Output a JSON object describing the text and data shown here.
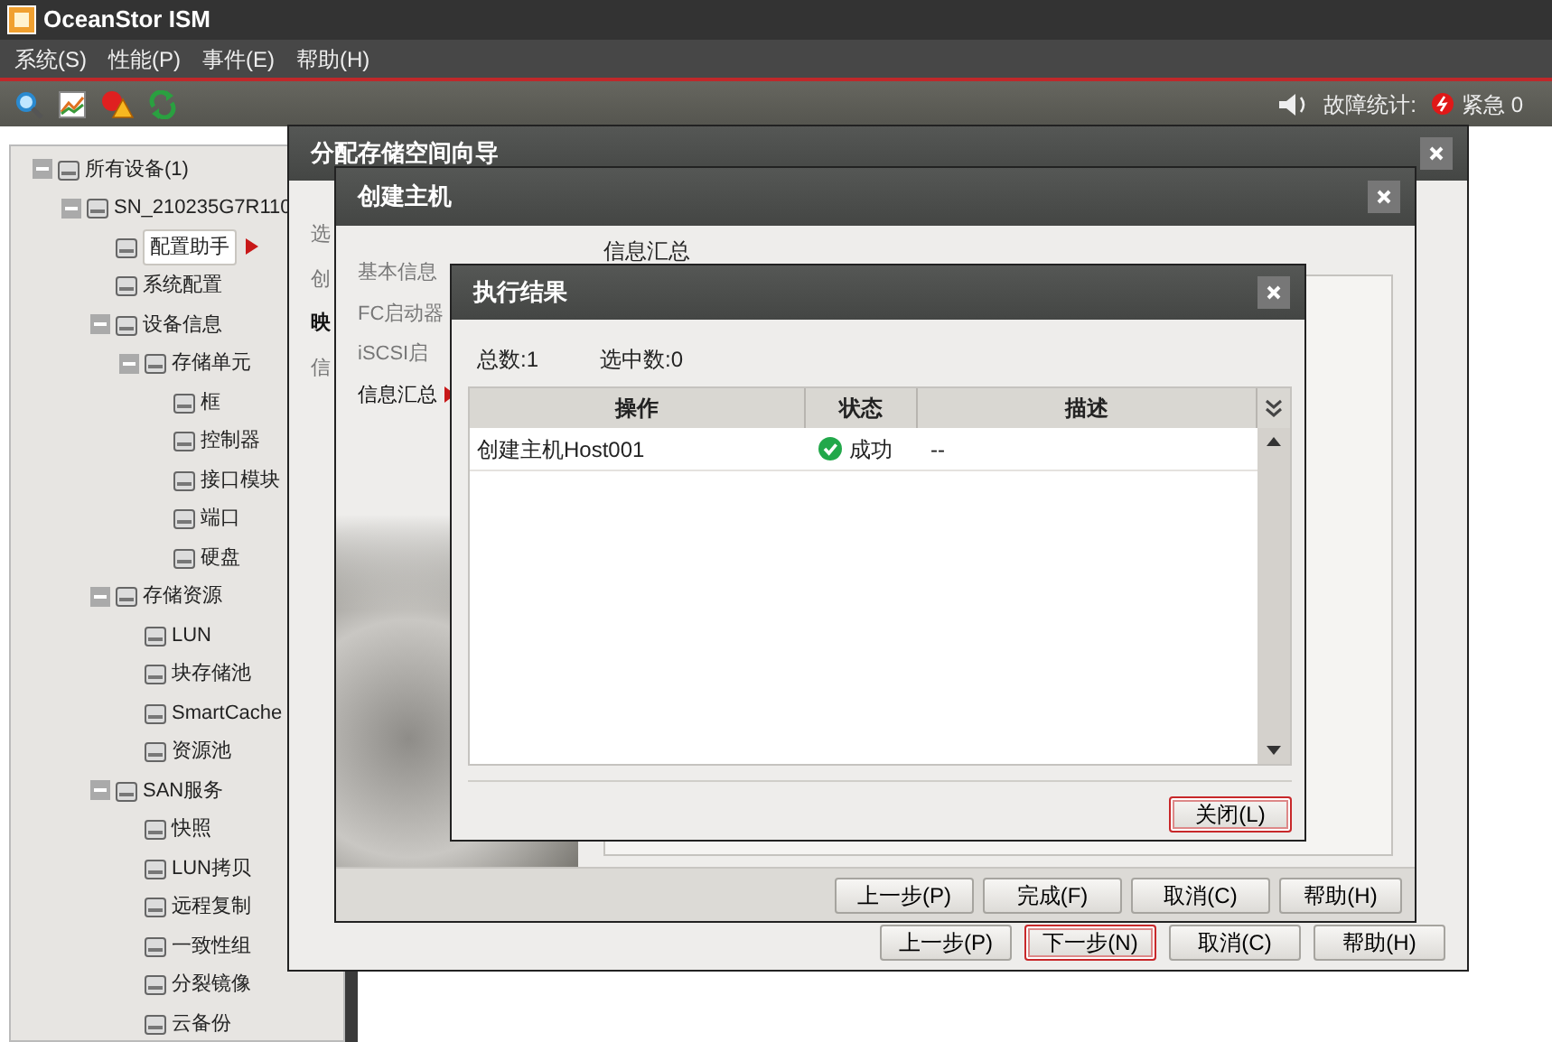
{
  "app": {
    "title": "OceanStor ISM"
  },
  "menu": [
    "系统(S)",
    "性能(P)",
    "事件(E)",
    "帮助(H)"
  ],
  "fault_summary": {
    "label": "故障统计:",
    "urgent": "紧急 0"
  },
  "tree": [
    {
      "label": "所有设备(1)",
      "expanded": true,
      "selected": false,
      "children": [
        {
          "label": "SN_210235G7R110",
          "expanded": true,
          "selected": false,
          "children": [
            {
              "label": "配置助手",
              "selected": true
            },
            {
              "label": "系统配置",
              "selected": false
            },
            {
              "label": "设备信息",
              "expanded": true,
              "selected": false,
              "children": [
                {
                  "label": "存储单元",
                  "expanded": true,
                  "selected": false,
                  "children": [
                    {
                      "label": "框",
                      "selected": false
                    },
                    {
                      "label": "控制器",
                      "selected": false
                    },
                    {
                      "label": "接口模块",
                      "selected": false
                    },
                    {
                      "label": "端口",
                      "selected": false
                    },
                    {
                      "label": "硬盘",
                      "selected": false
                    }
                  ]
                }
              ]
            },
            {
              "label": "存储资源",
              "expanded": true,
              "selected": false,
              "children": [
                {
                  "label": "LUN",
                  "selected": false
                },
                {
                  "label": "块存储池",
                  "selected": false
                },
                {
                  "label": "SmartCache",
                  "selected": false
                },
                {
                  "label": "资源池",
                  "selected": false
                }
              ]
            },
            {
              "label": "SAN服务",
              "expanded": true,
              "selected": false,
              "children": [
                {
                  "label": "快照",
                  "selected": false
                },
                {
                  "label": "LUN拷贝",
                  "selected": false
                },
                {
                  "label": "远程复制",
                  "selected": false
                },
                {
                  "label": "一致性组",
                  "selected": false
                },
                {
                  "label": "分裂镜像",
                  "selected": false
                },
                {
                  "label": "云备份",
                  "selected": false
                }
              ]
            }
          ]
        }
      ]
    }
  ],
  "wizard": {
    "title": "分配存储空间向导",
    "steps": [
      {
        "label": "选",
        "selected": false
      },
      {
        "label": "创",
        "selected": false
      },
      {
        "label": "映",
        "selected": true
      },
      {
        "label": "信",
        "selected": false
      }
    ],
    "buttons": [
      {
        "label": "上一步(P)",
        "focused": false
      },
      {
        "label": "下一步(N)",
        "focused": true
      },
      {
        "label": "取消(C)",
        "focused": false
      },
      {
        "label": "帮助(H)",
        "focused": false
      }
    ]
  },
  "host_dialog": {
    "title": "创建主机",
    "steps": [
      {
        "label": "基本信息",
        "selected": false
      },
      {
        "label": "FC启动器",
        "selected": false
      },
      {
        "label": "iSCSI启",
        "selected": false
      },
      {
        "label": "信息汇总",
        "selected": true
      }
    ],
    "section_title": "信息汇总",
    "buttons": [
      {
        "label": "上一步(P)",
        "focused": false
      },
      {
        "label": "完成(F)",
        "focused": false
      },
      {
        "label": "取消(C)",
        "focused": false
      },
      {
        "label": "帮助(H)",
        "focused": false
      }
    ]
  },
  "result_dialog": {
    "title": "执行结果",
    "total": "总数:1",
    "selected_count": "选中数:0",
    "table": {
      "columns": [
        "操作",
        "状态",
        "描述"
      ],
      "rows": [
        {
          "operation": "创建主机Host001",
          "status": "成功",
          "succeeded": true,
          "description": "--"
        }
      ]
    },
    "buttons": [
      {
        "label": "关闭(L)",
        "focused": true
      }
    ]
  }
}
